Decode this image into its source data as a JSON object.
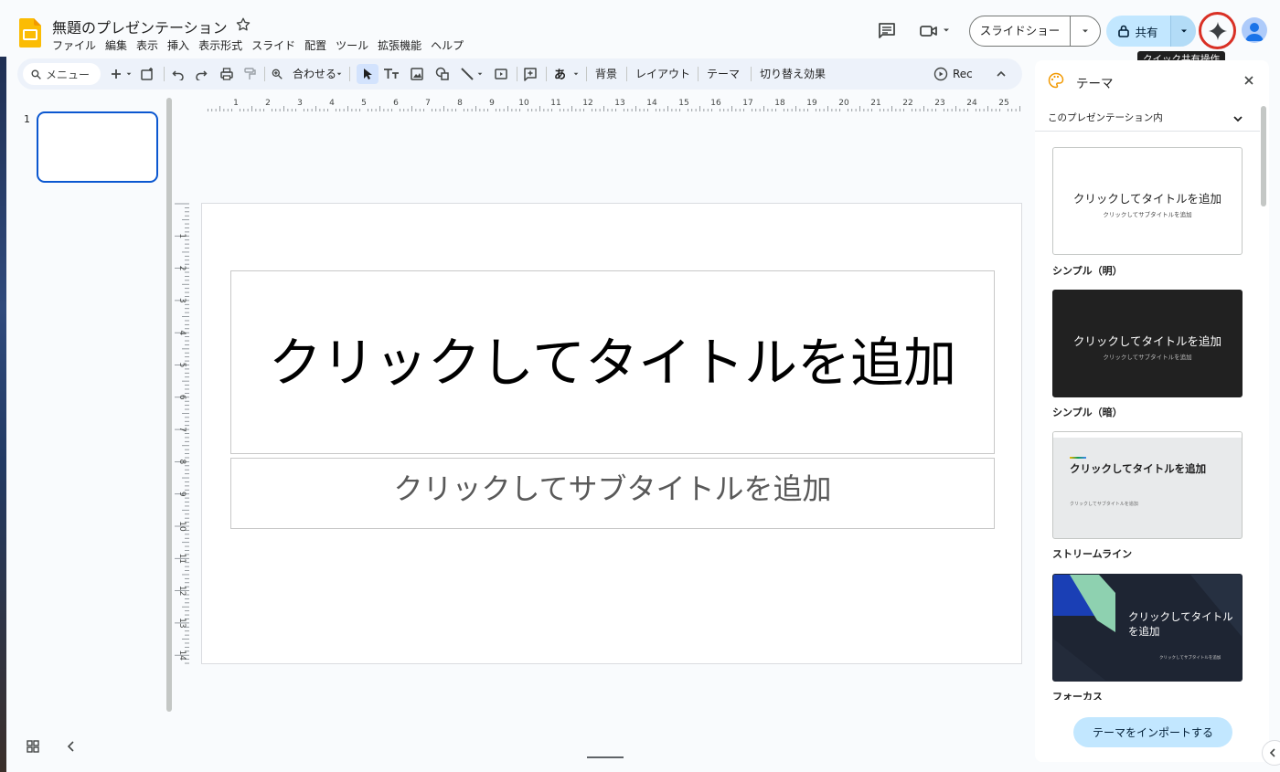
{
  "header": {
    "doc_title": "無題のプレゼンテーション",
    "menus": [
      "ファイル",
      "編集",
      "表示",
      "挿入",
      "表示形式",
      "スライド",
      "配置",
      "ツール",
      "拡張機能",
      "ヘルプ"
    ],
    "slideshow_label": "スライドショー",
    "share_label": "共有",
    "tooltip": "クイック共有操作"
  },
  "toolbar": {
    "menu_search": "メニュー",
    "zoom_label": "合わせる",
    "ime_label": "あ",
    "background_label": "背景",
    "layout_label": "レイアウト",
    "theme_label": "テーマ",
    "transition_label": "切り替え効果",
    "rec_label": "Rec"
  },
  "filmstrip": {
    "slide_number": "1"
  },
  "rulers": {
    "horizontal": [
      "1",
      "2",
      "3",
      "4",
      "5",
      "6",
      "7",
      "8",
      "9",
      "10",
      "11",
      "12",
      "13",
      "14",
      "15",
      "16",
      "17",
      "18",
      "19",
      "20",
      "21",
      "22",
      "23",
      "24",
      "25"
    ],
    "vertical": [
      "1",
      "2",
      "3",
      "4",
      "5",
      "6",
      "7",
      "8",
      "9",
      "10",
      "11",
      "12",
      "13",
      "14"
    ]
  },
  "slide": {
    "title_placeholder": "クリックしてタイトルを追加",
    "subtitle_placeholder": "クリックしてサブタイトルを追加"
  },
  "theme_panel": {
    "title": "テーマ",
    "scope": "このプレゼンテーション内",
    "themes": [
      {
        "name": "シンプル（明）",
        "preview_title": "クリックしてタイトルを追加",
        "preview_subtitle": "クリックしてサブタイトルを追加"
      },
      {
        "name": "シンプル（暗）",
        "preview_title": "クリックしてタイトルを追加",
        "preview_subtitle": "クリックしてサブタイトルを追加"
      },
      {
        "name": "ストリームライン",
        "preview_title": "クリックしてタイトルを追加",
        "preview_subtitle": "クリックしてサブタイトルを追加"
      },
      {
        "name": "フォーカス",
        "preview_title": "クリックしてタイトルを追加",
        "preview_subtitle": "クリックしてサブタイトルを追加"
      }
    ],
    "import_label": "テーマをインポートする"
  },
  "colors": {
    "accent_blue": "#0b57d0",
    "share_bg": "#c2e7ff",
    "highlight_red": "#d93025",
    "logo_yellow": "#fbbc04"
  }
}
